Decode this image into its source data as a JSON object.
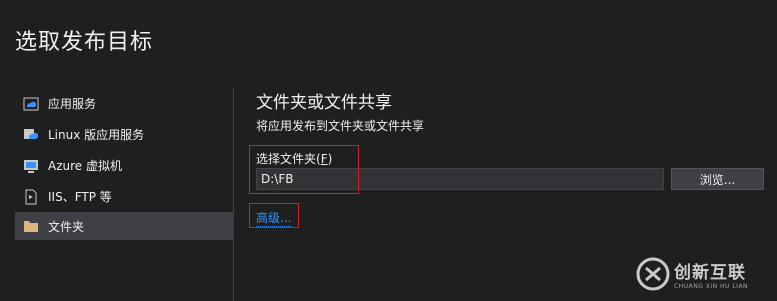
{
  "dialog": {
    "title": "选取发布目标"
  },
  "sidebar": {
    "items": [
      {
        "label": "应用服务",
        "icon": "cloud-app-service-icon",
        "selected": false
      },
      {
        "label": "Linux 版应用服务",
        "icon": "linux-app-service-icon",
        "selected": false
      },
      {
        "label": "Azure 虚拟机",
        "icon": "virtual-machine-icon",
        "selected": false
      },
      {
        "label": "IIS、FTP 等",
        "icon": "iis-ftp-icon",
        "selected": false
      },
      {
        "label": "文件夹",
        "icon": "folder-icon",
        "selected": true
      }
    ]
  },
  "main": {
    "heading": "文件夹或文件共享",
    "description": "将应用发布到文件夹或文件共享",
    "folder_label": "选择文件夹",
    "folder_hotkey": "F",
    "folder_value": "D:\\FB",
    "browse_label": "浏览...",
    "advanced_label": "高级..."
  },
  "watermark": {
    "cn": "创新互联",
    "en": "CHUANG XIN HU LIAN"
  },
  "colors": {
    "background": "#1f1f1f",
    "selected_bg": "#3f3f46",
    "link": "#3794ff",
    "highlight_box": "#d02020"
  }
}
